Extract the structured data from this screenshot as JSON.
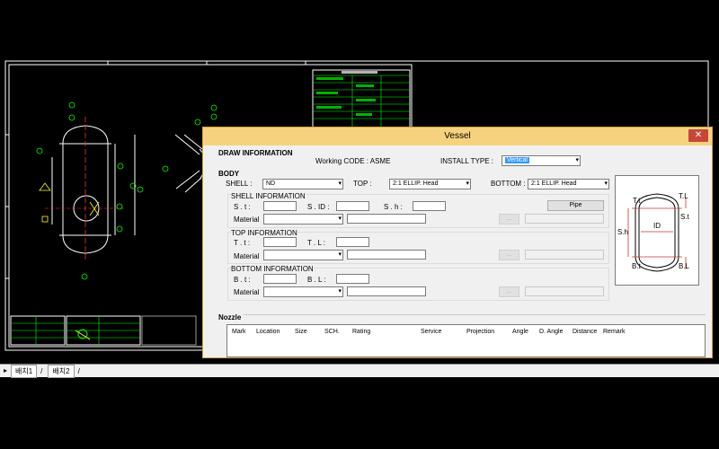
{
  "cad_tabs": [
    "배치1",
    "배치2"
  ],
  "dialog": {
    "title": "Vessel",
    "close_symbol": "✕",
    "draw_information": {
      "heading": "DRAW INFORMATION",
      "working_code_label": "Working CODE : ASME",
      "install_type_label": "INSTALL TYPE :",
      "install_type_value": "Vertical"
    },
    "body": {
      "heading": "BODY",
      "shell_label": "SHELL :",
      "shell_value": "ND",
      "top_label": "TOP :",
      "top_value": "2:1 ELLIP. Head",
      "bottom_label": "BOTTOM :",
      "bottom_value": "2:1 ELLIP. Head"
    },
    "shell_info": {
      "heading": "SHELL INFORMATION",
      "st_label": "S . t :",
      "sid_label": "S . ID :",
      "sh_label": "S . h :",
      "material_label": "Material",
      "browse_label": "...",
      "pipe_label": "Pipe"
    },
    "top_info": {
      "heading": "TOP INFORMATION",
      "tt_label": "T . t :",
      "tl_label": "T . L :",
      "material_label": "Material",
      "browse_label": "..."
    },
    "bottom_info": {
      "heading": "BOTTOM INFORMATION",
      "bt_label": "B . t :",
      "bl_label": "B . L :",
      "material_label": "Material",
      "browse_label": "..."
    },
    "preview": {
      "tt": "T.t",
      "tl": "T.L",
      "id": "ID",
      "st": "S.t",
      "sh": "S.h",
      "bt": "B.t",
      "bl": "B.L"
    },
    "nozzle": {
      "heading": "Nozzle",
      "columns": [
        "Mark",
        "Location",
        "Size",
        "SCH.",
        "Rating",
        "Service",
        "Projection",
        "Angle",
        "D. Angle",
        "Distance",
        "Remark"
      ]
    }
  },
  "colors": {
    "cad_background": "#000000",
    "cad_line": "#ffffff",
    "cad_green": "#00ff00",
    "cad_red": "#ff3030",
    "cad_yellow": "#ffff00",
    "dialog_title_bg": "#f6d27e",
    "close_bg": "#c7463a",
    "selection": "#3399ff"
  }
}
